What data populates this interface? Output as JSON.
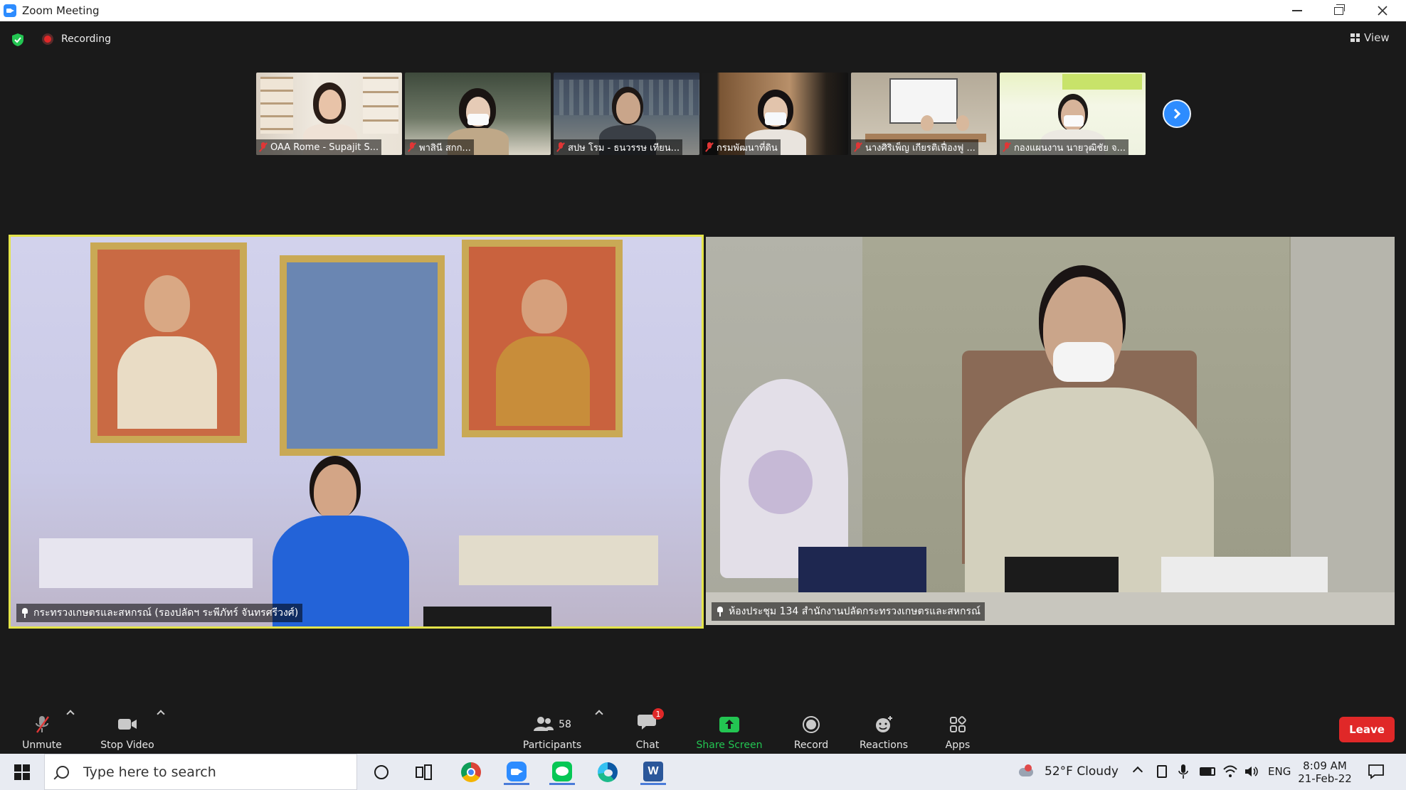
{
  "window": {
    "title": "Zoom Meeting"
  },
  "status": {
    "recording_label": "Recording",
    "view_label": "View"
  },
  "thumbnails": [
    {
      "name": "OAA Rome - Supajit S..."
    },
    {
      "name": "พาสินี สกก..."
    },
    {
      "name": "สปษ โรม - ธนวรรษ เทียน..."
    },
    {
      "name": "กรมพัฒนาที่ดิน"
    },
    {
      "name": "นางศิริเพ็ญ เกียรติเฟื่องฟู ..."
    },
    {
      "name": "กองแผนงาน นายวุฒิชัย จ..."
    }
  ],
  "videos": {
    "left_name": "กระทรวงเกษตรและสหกรณ์ (รองปลัดฯ ระพีภัทร์ จันทรศรีวงศ์)",
    "right_name": "ห้องประชุม 134 สำนักงานปลัดกระทรวงเกษตรและสหกรณ์"
  },
  "toolbar": {
    "unmute": "Unmute",
    "stop_video": "Stop Video",
    "participants": "Participants",
    "participants_count": "58",
    "chat": "Chat",
    "chat_badge": "1",
    "share_screen": "Share Screen",
    "record": "Record",
    "reactions": "Reactions",
    "apps": "Apps",
    "leave": "Leave"
  },
  "taskbar": {
    "search_placeholder": "Type here to search",
    "weather": "52°F  Cloudy",
    "language": "ENG",
    "time": "8:09 AM",
    "date": "21-Feb-22"
  },
  "colors": {
    "accent": "#2d8cff",
    "active_speaker_border": "#e4e44a",
    "leave": "#e02828",
    "share_green": "#23c552",
    "muted_red": "#e03636"
  }
}
